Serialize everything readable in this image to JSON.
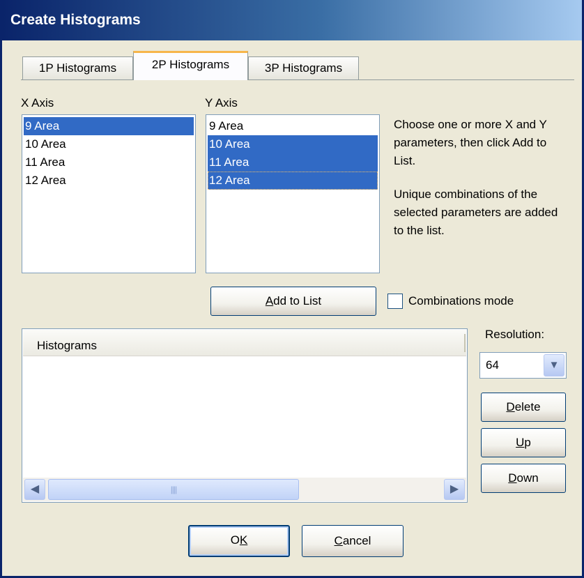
{
  "window": {
    "title": "Create Histograms"
  },
  "tabs": [
    {
      "label": "1P Histograms",
      "active": false
    },
    {
      "label": "2P Histograms",
      "active": true
    },
    {
      "label": "3P Histograms",
      "active": false
    }
  ],
  "x_axis": {
    "label": "X Axis",
    "items": [
      {
        "text": "9 Area",
        "selected": true
      },
      {
        "text": "10 Area",
        "selected": false
      },
      {
        "text": "11 Area",
        "selected": false
      },
      {
        "text": "12 Area",
        "selected": false
      }
    ]
  },
  "y_axis": {
    "label": "Y Axis",
    "items": [
      {
        "text": "9 Area",
        "selected": false
      },
      {
        "text": "10 Area",
        "selected": true
      },
      {
        "text": "11 Area",
        "selected": true
      },
      {
        "text": "12 Area",
        "selected": true
      }
    ]
  },
  "help": {
    "line1": "Choose one or more X and Y parameters, then click Add to List.",
    "line2": "Unique combinations of the selected parameters are added to the list."
  },
  "buttons": {
    "add_to_list_first": "A",
    "add_to_list_rest": "dd to List",
    "delete_first": "D",
    "delete_rest": "elete",
    "up_first": "U",
    "up_rest": "p",
    "down_first": "D",
    "down_rest": "own",
    "ok_first": "O",
    "ok_underlined": "K",
    "cancel_first": "C",
    "cancel_rest": "ancel"
  },
  "combinations_mode": {
    "label": "Combinations mode",
    "checked": false
  },
  "histograms": {
    "column_header": "Histograms",
    "rows": []
  },
  "resolution": {
    "label": "Resolution:",
    "value": "64"
  },
  "icons": {
    "scroll_left": "◀",
    "scroll_right": "▶",
    "dropdown": "▼",
    "grip": "||||"
  },
  "colors": {
    "selection": "#316ac5",
    "titlebar": "#0a246a",
    "tab_highlight": "#f7b64a",
    "dialog_bg": "#ece9d8"
  }
}
